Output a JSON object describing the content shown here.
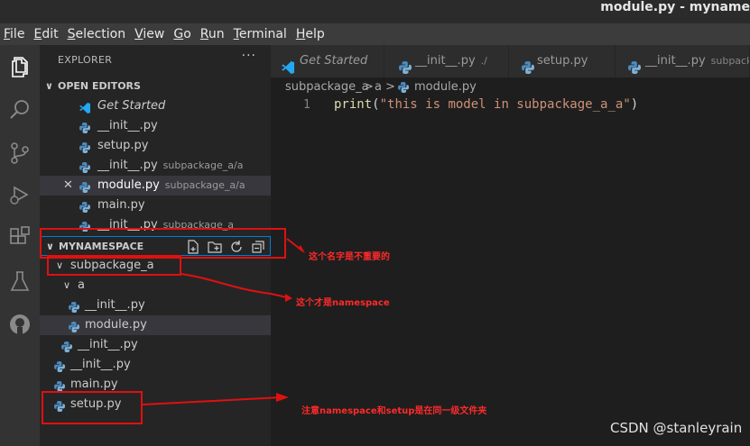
{
  "window": {
    "title": "module.py - myname"
  },
  "menu": [
    "File",
    "Edit",
    "Selection",
    "View",
    "Go",
    "Run",
    "Terminal",
    "Help"
  ],
  "sidebar": {
    "header": "EXPLORER",
    "more": "···",
    "open_editors": {
      "title": "OPEN EDITORS",
      "items": [
        {
          "name": "Get Started",
          "desc": ""
        },
        {
          "name": "__init__.py",
          "desc": ""
        },
        {
          "name": "setup.py",
          "desc": ""
        },
        {
          "name": "__init__.py",
          "desc": "subpackage_a/a"
        },
        {
          "name": "module.py",
          "desc": "subpackage_a/a"
        },
        {
          "name": "main.py",
          "desc": ""
        },
        {
          "name": "__init__.py",
          "desc": "subpackage_a"
        }
      ]
    },
    "workspace": {
      "title": "MYNAMESPACE",
      "tree": [
        {
          "name": "subpackage_a"
        },
        {
          "name": "a"
        },
        {
          "name": "__init__.py"
        },
        {
          "name": "module.py"
        },
        {
          "name": "__init__.py"
        },
        {
          "name": "__init__.py"
        },
        {
          "name": "main.py"
        },
        {
          "name": "setup.py"
        }
      ]
    }
  },
  "tabs": [
    {
      "label": "Get Started",
      "desc": ""
    },
    {
      "label": "__init__.py",
      "desc": "./"
    },
    {
      "label": "setup.py",
      "desc": ""
    },
    {
      "label": "__init__.py",
      "desc": "subpackage_a"
    }
  ],
  "breadcrumb": {
    "part1": "subpackage_a",
    "sep1": ">",
    "part2": "a",
    "sep2": ">",
    "part3": "module.py"
  },
  "editor": {
    "line_number": "1",
    "code_fn": "print",
    "code_open": "(",
    "code_str": "\"this is model in subpackage_a_a\"",
    "code_close": ")"
  },
  "annotations": {
    "note1": "这个名字是不重要的",
    "note2": "这个才是namespace",
    "note3": "注意namespace和setup是在同一级文件夹"
  },
  "watermark": "CSDN @stanleyrain",
  "colors": {
    "accent_red": "#e01010",
    "python_blue": "#4b8bbe",
    "vscode_blue": "#23a9f2"
  }
}
